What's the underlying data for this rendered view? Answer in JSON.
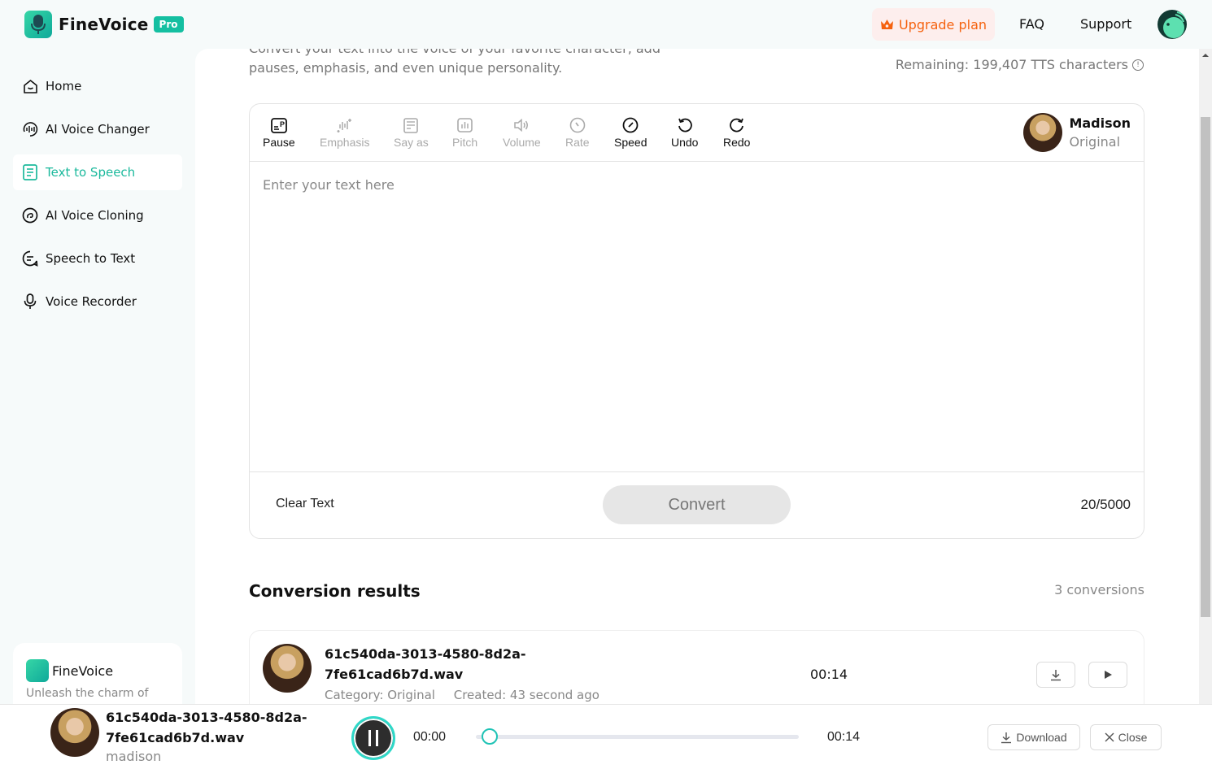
{
  "header": {
    "brand": "FineVoice",
    "badge": "Pro",
    "upgrade_label": "Upgrade plan",
    "faq_label": "FAQ",
    "support_label": "Support",
    "accent_color": "#14bfa1",
    "upgrade_color": "#f5620f"
  },
  "sidebar": {
    "items": [
      {
        "label": "Home",
        "icon": "home-icon",
        "active": false
      },
      {
        "label": "AI Voice Changer",
        "icon": "voice-changer-icon",
        "active": false
      },
      {
        "label": "Text to Speech",
        "icon": "document-icon",
        "active": true
      },
      {
        "label": "AI Voice Cloning",
        "icon": "cloning-icon",
        "active": false
      },
      {
        "label": "Speech to Text",
        "icon": "chat-icon",
        "active": false
      },
      {
        "label": "Voice Recorder",
        "icon": "microphone-icon",
        "active": false
      }
    ],
    "promo": {
      "title": "FineVoice",
      "description": "Unleash the charm of"
    }
  },
  "main": {
    "subtitle": "Convert your text into the voice of your favorite character, add pauses, emphasis, and even unique personality.",
    "remaining": "Remaining: 199,407 TTS characters",
    "editor": {
      "tools": [
        {
          "label": "Pause",
          "icon": "pause-tag-icon",
          "enabled": true
        },
        {
          "label": "Emphasis",
          "icon": "emphasis-icon",
          "enabled": false
        },
        {
          "label": "Say as",
          "icon": "say-as-icon",
          "enabled": false
        },
        {
          "label": "Pitch",
          "icon": "pitch-icon",
          "enabled": false
        },
        {
          "label": "Volume",
          "icon": "volume-icon",
          "enabled": false
        },
        {
          "label": "Rate",
          "icon": "rate-icon",
          "enabled": false
        },
        {
          "label": "Speed",
          "icon": "speed-icon",
          "enabled": true
        },
        {
          "label": "Undo",
          "icon": "undo-icon",
          "enabled": true
        },
        {
          "label": "Redo",
          "icon": "redo-icon",
          "enabled": true
        }
      ],
      "voice": {
        "name": "Madison",
        "category": "Original"
      },
      "placeholder": "Enter your text here",
      "value": "",
      "clear_label": "Clear Text",
      "convert_label": "Convert",
      "char_count": "20/5000"
    },
    "results": {
      "title": "Conversion results",
      "count": "3 conversions",
      "items": [
        {
          "filename": "61c540da-3013-4580-8d2a-7fe61cad6b7d.wav",
          "category": "Category: Original",
          "created": "Created: 43 second ago",
          "duration": "00:14"
        }
      ]
    }
  },
  "player": {
    "filename": "61c540da-3013-4580-8d2a-7fe61cad6b7d.wav",
    "voice": "madison",
    "current_time": "00:00",
    "total_time": "00:14",
    "progress": 0.02,
    "download_label": "Download",
    "close_label": "Close"
  }
}
